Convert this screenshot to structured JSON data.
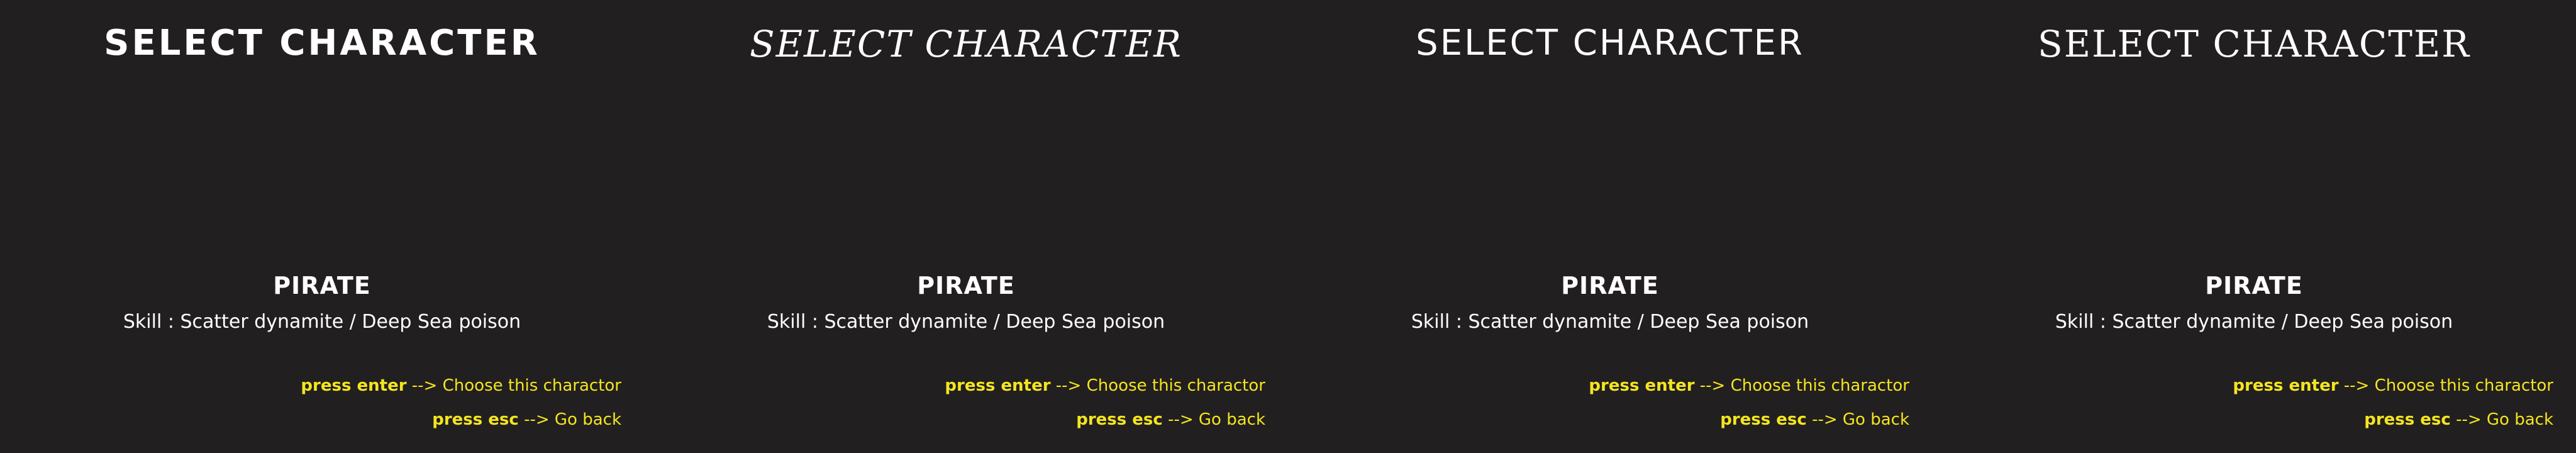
{
  "screen": {
    "title": "SELECT CHARACTER",
    "character": {
      "name": "PIRATE",
      "skill": "Skill : Scatter dynamite / Deep Sea poison"
    },
    "controls": {
      "enter_key": "press enter",
      "enter_arrow": "-->",
      "enter_action": "Choose this charactor",
      "esc_key": "press esc",
      "esc_arrow": "-->",
      "esc_action": "Go back"
    }
  },
  "colors": {
    "background": "#221f20",
    "text": "#ffffff",
    "hint": "#f4e51e"
  }
}
